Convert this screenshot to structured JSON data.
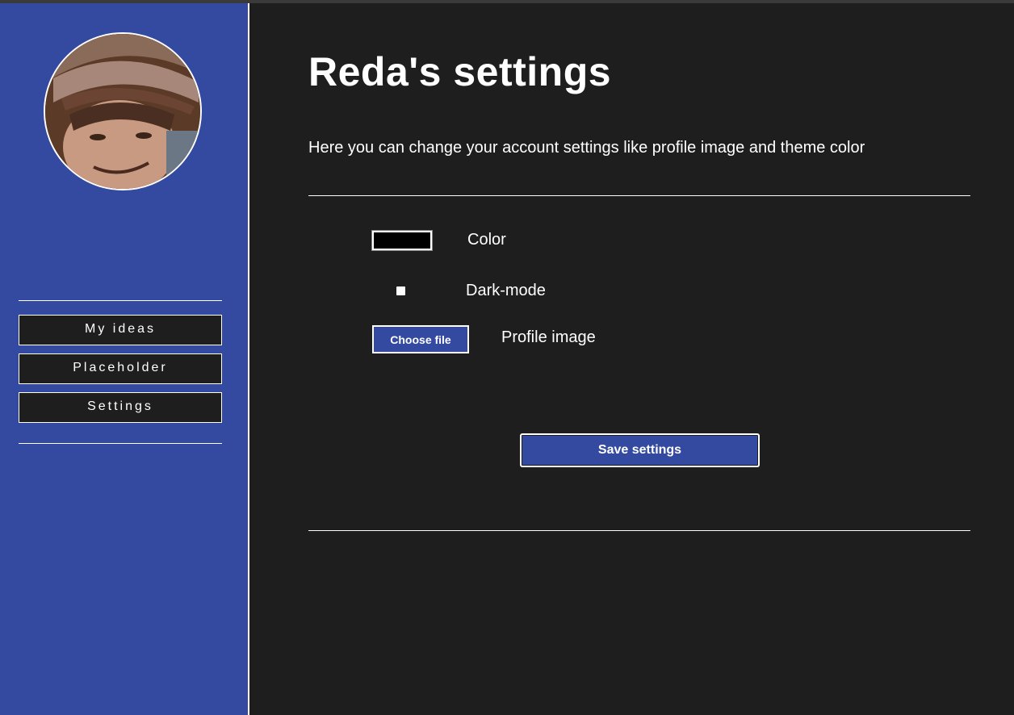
{
  "sidebar": {
    "nav": [
      {
        "label": "My ideas"
      },
      {
        "label": "Placeholder"
      },
      {
        "label": "Settings"
      }
    ]
  },
  "main": {
    "title": "Reda's settings",
    "description": "Here you can change your account settings like profile image and theme color",
    "color_label": "Color",
    "color_value": "#000000",
    "dark_mode_label": "Dark-mode",
    "dark_mode_checked": false,
    "file_button_label": "Choose file",
    "profile_image_label": "Profile image",
    "save_label": "Save settings"
  },
  "colors": {
    "sidebar": "#334aa0",
    "background": "#1e1e1e",
    "accent": "#334aa0",
    "text": "#ffffff"
  }
}
